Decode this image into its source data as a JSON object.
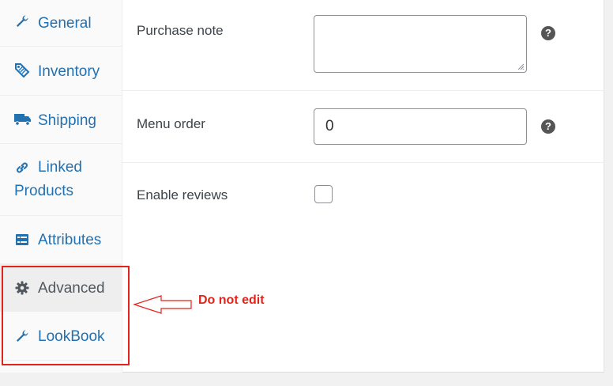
{
  "tabs": [
    {
      "label": "General",
      "icon": "wrench-icon"
    },
    {
      "label": "Inventory",
      "icon": "tag-icon"
    },
    {
      "label": "Shipping",
      "icon": "truck-icon"
    },
    {
      "label": "Linked Products",
      "icon": "link-icon"
    },
    {
      "label": "Attributes",
      "icon": "list-icon"
    },
    {
      "label": "Advanced",
      "icon": "gear-icon",
      "active": true
    },
    {
      "label": "LookBook",
      "icon": "wrench-icon"
    }
  ],
  "fields": {
    "purchase_note": {
      "label": "Purchase note",
      "value": ""
    },
    "menu_order": {
      "label": "Menu order",
      "value": "0"
    },
    "enable_reviews": {
      "label": "Enable reviews",
      "checked": false
    }
  },
  "help_glyph": "?",
  "annotation": {
    "text": "Do not edit",
    "color": "#e2231a"
  },
  "colors": {
    "link": "#2271b1",
    "accent_red": "#e2231a"
  }
}
